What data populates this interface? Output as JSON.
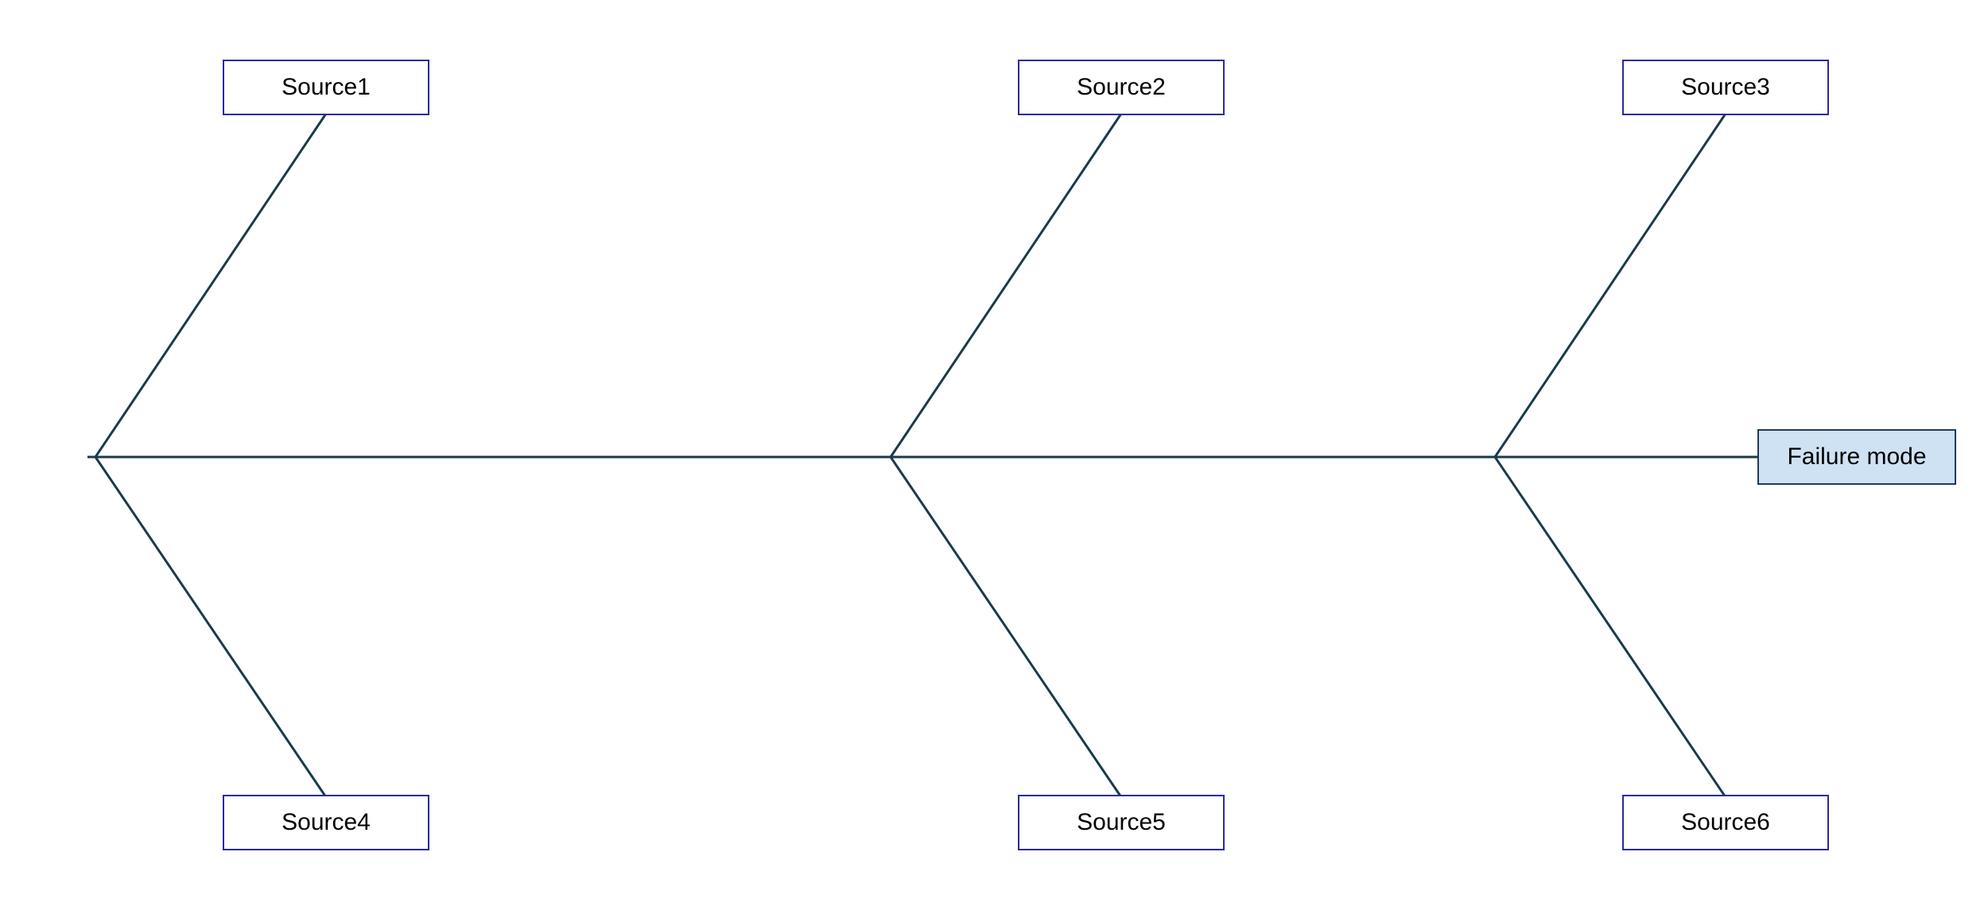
{
  "diagram": {
    "type": "fishbone",
    "head": {
      "label": "Failure mode"
    },
    "sources_top": [
      {
        "label": "Source1"
      },
      {
        "label": "Source2"
      },
      {
        "label": "Source3"
      }
    ],
    "sources_bottom": [
      {
        "label": "Source4"
      },
      {
        "label": "Source5"
      },
      {
        "label": "Source6"
      }
    ],
    "colors": {
      "bone": "#1b3a4b",
      "box_border": "#2a2aa0",
      "head_fill": "#cfe2f3"
    }
  }
}
